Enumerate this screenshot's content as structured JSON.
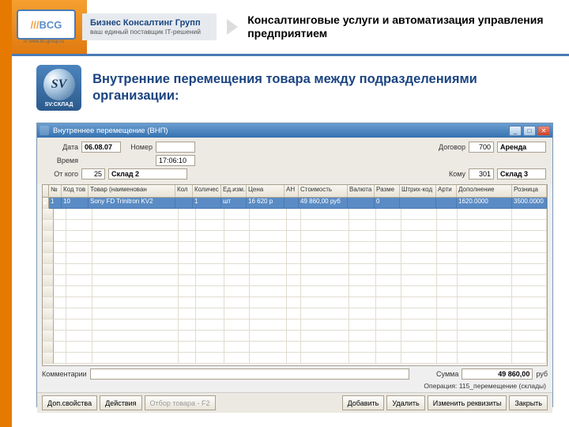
{
  "brand": {
    "logo_text": "BCG",
    "logo_sub": "/// www.bc-group.ru",
    "company_line1": "Бизнес Консалтинг Групп",
    "company_line2": "ваш единый поставщик IT-решений"
  },
  "headline": "Консалтинговые услуги и автоматизация управления предприятием",
  "sv_badge": {
    "initials": "SV",
    "label": "SV:СКЛАД"
  },
  "section_title": "Внутренние перемещения товара между подразделениями организации:",
  "win": {
    "title": "Внутреннее перемещение  (ВНП)"
  },
  "form": {
    "date_lbl": "Дата",
    "date_val": "06.08.07",
    "number_lbl": "Номер",
    "number_val": "",
    "time_lbl": "Время",
    "time_val": "17:06:10",
    "contract_lbl": "Договор",
    "contract_code": "700",
    "contract_name": "Аренда",
    "from_lbl": "От кого",
    "from_code": "25",
    "from_name": "Склад 2",
    "to_lbl": "Кому",
    "to_code": "301",
    "to_name": "Склад 3"
  },
  "grid": {
    "headers": [
      "№",
      "Код тов",
      "Товар (наименован",
      "Кол",
      "Количес",
      "Ед.изм.",
      "Цена",
      "АН",
      "Стоимость",
      "Валюта",
      "Разме",
      "Штрих-код",
      "Арти",
      "Дополнение",
      "Розница"
    ],
    "widths": [
      16,
      34,
      110,
      22,
      36,
      32,
      48,
      18,
      62,
      34,
      32,
      46,
      26,
      70,
      44
    ],
    "row": [
      "1",
      "10",
      "Sony FD Trinitron KV2",
      "",
      "1",
      "шт",
      "16 620 р",
      "",
      "49 860,00 руб",
      "",
      "0",
      "",
      "",
      "1620.0000",
      "3500.0000"
    ]
  },
  "footer": {
    "comment_lbl": "Комментарии",
    "sum_lbl": "Сумма",
    "sum_val": "49 860,00",
    "sum_cur": "руб",
    "operation": "Операция: 115_перемещение (склады)"
  },
  "buttons": {
    "props": "Доп.свойства",
    "actions": "Действия",
    "filter": "Отбор товара - F2",
    "add": "Добавить",
    "del": "Удалить",
    "edit": "Изменить реквизиты",
    "close": "Закрыть"
  }
}
